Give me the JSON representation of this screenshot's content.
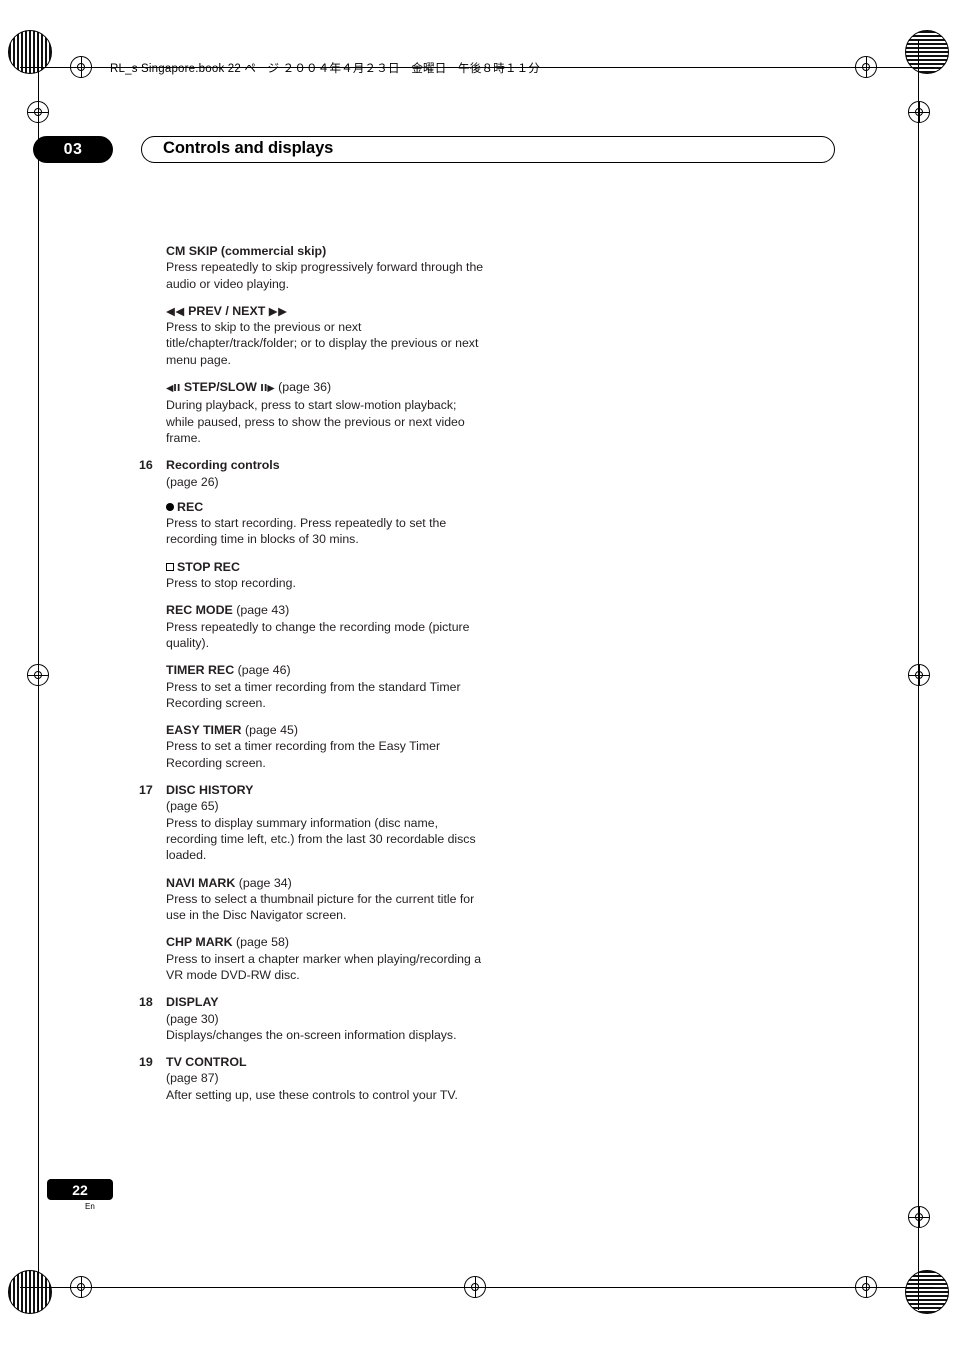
{
  "header": {
    "file_line": "RL_s Singapore.book 22 ページ ２００４年４月２３日　金曜日　午後８時１１分"
  },
  "chapter": {
    "number": "03",
    "title": "Controls and displays"
  },
  "body": [
    {
      "id": "cm-skip",
      "indent": true,
      "number": "",
      "heading": "CM SKIP (commercial skip)",
      "page_ref": "",
      "description": "Press repeatedly to skip progressively forward through the audio or video playing."
    },
    {
      "id": "prev-next",
      "indent": true,
      "number": "",
      "heading_symbol": "◀◀ PREV / NEXT ▶▶",
      "heading": "PREV / NEXT",
      "page_ref": "",
      "description": "Press to skip to the previous or next title/chapter/track/folder; or to display the previous or next menu page."
    },
    {
      "id": "step-slow",
      "indent": true,
      "number": "",
      "heading": "STEP/SLOW",
      "page_ref": "(page 36)",
      "description": "During playback, press to start slow-motion playback; while paused, press to show the previous or next video frame."
    },
    {
      "id": "recording-controls",
      "indent": false,
      "number": "16",
      "heading": "Recording controls",
      "page_ref": "(page 26)",
      "description": ""
    },
    {
      "id": "rec",
      "indent": true,
      "number": "",
      "heading": "REC",
      "page_ref": "",
      "description": "Press to start recording. Press repeatedly to set the recording time in blocks of 30 mins."
    },
    {
      "id": "stop-rec",
      "indent": true,
      "number": "",
      "heading": "STOP REC",
      "page_ref": "",
      "description": "Press to stop recording."
    },
    {
      "id": "rec-mode",
      "indent": true,
      "number": "",
      "heading": "REC MODE",
      "page_ref": "(page 43)",
      "description": "Press repeatedly to change the recording mode (picture quality)."
    },
    {
      "id": "timer-rec",
      "indent": true,
      "number": "",
      "heading": "TIMER REC",
      "page_ref": "(page 46)",
      "description": "Press to set a timer recording from the standard Timer Recording screen."
    },
    {
      "id": "easy-timer",
      "indent": true,
      "number": "",
      "heading": "EASY TIMER",
      "page_ref": "(page 45)",
      "description": "Press to set a timer recording from the Easy Timer Recording screen."
    },
    {
      "id": "disc-history",
      "indent": false,
      "number": "17",
      "heading": "DISC HISTORY",
      "page_ref": "(page 65)",
      "description": "Press to display summary information (disc name, recording time left, etc.) from the last 30 recordable discs loaded."
    },
    {
      "id": "navi-mark",
      "indent": true,
      "number": "",
      "heading": "NAVI MARK",
      "page_ref": "(page 34)",
      "description": "Press to select a thumbnail picture for the current title for use in the Disc Navigator screen."
    },
    {
      "id": "chp-mark",
      "indent": true,
      "number": "",
      "heading": "CHP MARK",
      "page_ref": "(page 58)",
      "description": "Press to insert a chapter marker when playing/recording a VR mode DVD-RW disc."
    },
    {
      "id": "display",
      "indent": false,
      "number": "18",
      "heading": "DISPLAY",
      "page_ref": "(page 30)",
      "description": "Displays/changes the on-screen information displays."
    },
    {
      "id": "tv-control",
      "indent": false,
      "number": "19",
      "heading": "TV CONTROL",
      "page_ref": "(page 87)",
      "description": "After setting up, use these controls to control your TV."
    }
  ],
  "footer": {
    "page_number": "22",
    "language": "En"
  },
  "symbols": {
    "prev": "◀◀",
    "next": "▶▶",
    "step_back": "◀II",
    "step_fwd": "II▶",
    "step_slow_label": "STEP/SLOW"
  }
}
